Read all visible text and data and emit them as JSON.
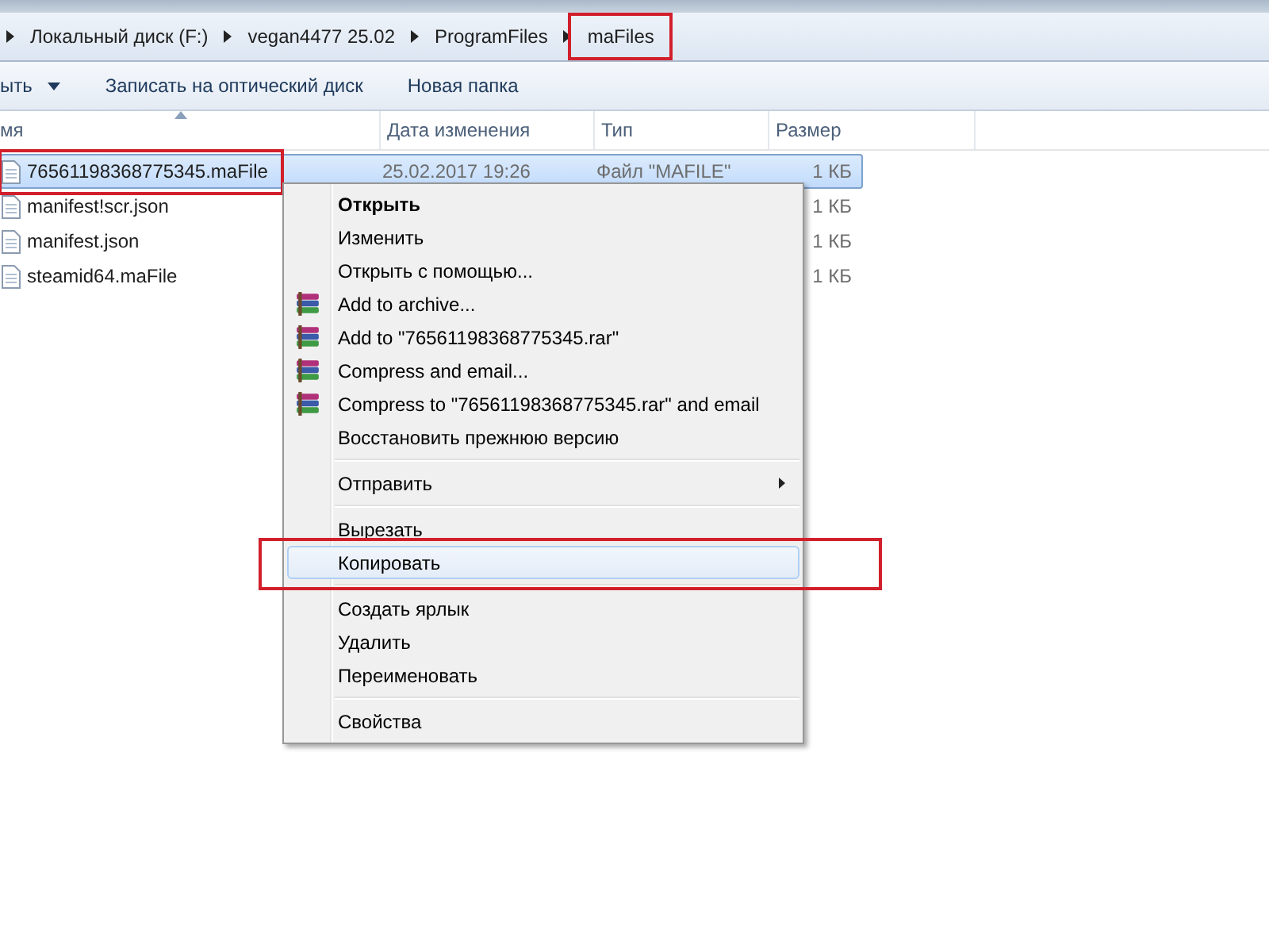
{
  "breadcrumbs": [
    {
      "label": "Локальный диск (F:)",
      "highlighted": false
    },
    {
      "label": "vegan4477 25.02",
      "highlighted": false
    },
    {
      "label": "ProgramFiles",
      "highlighted": false
    },
    {
      "label": "maFiles",
      "highlighted": true
    }
  ],
  "toolbar": [
    {
      "label": "ыть",
      "dropdown": true
    },
    {
      "label": "Записать на оптический диск",
      "dropdown": false
    },
    {
      "label": "Новая папка",
      "dropdown": false
    }
  ],
  "columns": [
    "мя",
    "Дата изменения",
    "Тип",
    "Размер"
  ],
  "files": [
    {
      "name": "76561198368775345.maFile",
      "date": "25.02.2017 19:26",
      "type": "Файл \"MAFILE\"",
      "size": "1 КБ",
      "selected": true,
      "highlighted": true
    },
    {
      "name": "manifest!scr.json",
      "size": "1 КБ",
      "selected": false,
      "highlighted": false
    },
    {
      "name": "manifest.json",
      "size": "1 КБ",
      "selected": false,
      "highlighted": false
    },
    {
      "name": "steamid64.maFile",
      "size": "1 КБ",
      "selected": false,
      "highlighted": false
    }
  ],
  "context_menu": [
    {
      "kind": "item",
      "label": "Открыть",
      "bold": true,
      "icon": false,
      "submenu": false,
      "hovered": false,
      "highlighted": false
    },
    {
      "kind": "item",
      "label": "Изменить",
      "bold": false,
      "icon": false,
      "submenu": false,
      "hovered": false,
      "highlighted": false
    },
    {
      "kind": "item",
      "label": "Открыть с помощью...",
      "bold": false,
      "icon": false,
      "submenu": false,
      "hovered": false,
      "highlighted": false
    },
    {
      "kind": "item",
      "label": "Add to archive...",
      "bold": false,
      "icon": true,
      "submenu": false,
      "hovered": false,
      "highlighted": false
    },
    {
      "kind": "item",
      "label": "Add to \"76561198368775345.rar\"",
      "bold": false,
      "icon": true,
      "submenu": false,
      "hovered": false,
      "highlighted": false
    },
    {
      "kind": "item",
      "label": "Compress and email...",
      "bold": false,
      "icon": true,
      "submenu": false,
      "hovered": false,
      "highlighted": false
    },
    {
      "kind": "item",
      "label": "Compress to \"76561198368775345.rar\" and email",
      "bold": false,
      "icon": true,
      "submenu": false,
      "hovered": false,
      "highlighted": false
    },
    {
      "kind": "item",
      "label": "Восстановить прежнюю версию",
      "bold": false,
      "icon": false,
      "submenu": false,
      "hovered": false,
      "highlighted": false
    },
    {
      "kind": "separator"
    },
    {
      "kind": "item",
      "label": "Отправить",
      "bold": false,
      "icon": false,
      "submenu": true,
      "hovered": false,
      "highlighted": false
    },
    {
      "kind": "separator"
    },
    {
      "kind": "item",
      "label": "Вырезать",
      "bold": false,
      "icon": false,
      "submenu": false,
      "hovered": false,
      "highlighted": false
    },
    {
      "kind": "item",
      "label": "Копировать",
      "bold": false,
      "icon": false,
      "submenu": false,
      "hovered": true,
      "highlighted": true
    },
    {
      "kind": "separator"
    },
    {
      "kind": "item",
      "label": "Создать ярлык",
      "bold": false,
      "icon": false,
      "submenu": false,
      "hovered": false,
      "highlighted": false
    },
    {
      "kind": "item",
      "label": "Удалить",
      "bold": false,
      "icon": false,
      "submenu": false,
      "hovered": false,
      "highlighted": false
    },
    {
      "kind": "item",
      "label": "Переименовать",
      "bold": false,
      "icon": false,
      "submenu": false,
      "hovered": false,
      "highlighted": false
    },
    {
      "kind": "separator"
    },
    {
      "kind": "item",
      "label": "Свойства",
      "bold": false,
      "icon": false,
      "submenu": false,
      "hovered": false,
      "highlighted": false
    }
  ]
}
